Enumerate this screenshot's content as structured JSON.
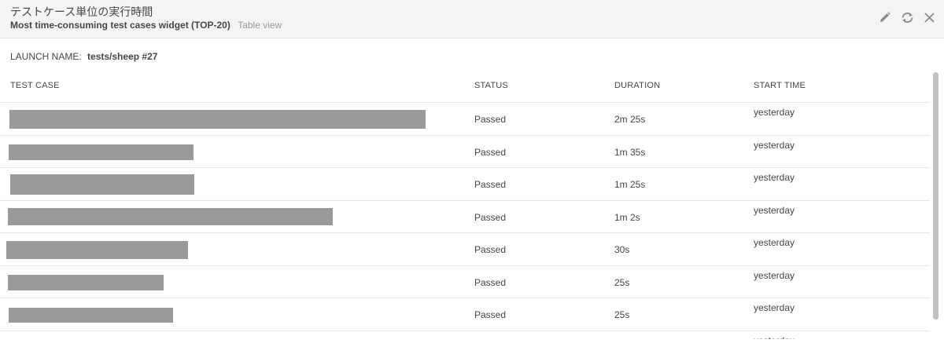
{
  "header": {
    "title": "テストケース単位の実行時間",
    "subtitle": "Most time-consuming test cases widget (TOP-20)",
    "view_mode": "Table view",
    "controls": [
      {
        "icon": "pencil-icon",
        "name": "edit-button"
      },
      {
        "icon": "refresh-icon",
        "name": "refresh-button"
      },
      {
        "icon": "close-icon",
        "name": "close-button"
      }
    ]
  },
  "launch": {
    "label": "LAUNCH NAME:",
    "value": "tests/sheep #27"
  },
  "table": {
    "columns": {
      "test_case": "TEST CASE",
      "status": "STATUS",
      "duration": "DURATION",
      "start_time": "START TIME"
    },
    "rows": [
      {
        "test_case_redacted": true,
        "status": "Passed",
        "duration": "2m 25s",
        "start_time": "yesterday"
      },
      {
        "test_case_redacted": true,
        "status": "Passed",
        "duration": "1m 35s",
        "start_time": "yesterday"
      },
      {
        "test_case_redacted": true,
        "status": "Passed",
        "duration": "1m 25s",
        "start_time": "yesterday"
      },
      {
        "test_case_redacted": true,
        "status": "Passed",
        "duration": "1m 2s",
        "start_time": "yesterday"
      },
      {
        "test_case_redacted": true,
        "status": "Passed",
        "duration": "30s",
        "start_time": "yesterday"
      },
      {
        "test_case_redacted": true,
        "status": "Passed",
        "duration": "25s",
        "start_time": "yesterday"
      },
      {
        "test_case_redacted": true,
        "status": "Passed",
        "duration": "25s",
        "start_time": "yesterday"
      },
      {
        "test_case_redacted": true,
        "status": "",
        "duration": "",
        "start_time": "yesterday"
      }
    ]
  },
  "colors": {
    "header_bg": "#f4f4f4",
    "redaction": "#9a9a9a",
    "text": "#464547",
    "muted": "#999999",
    "divider": "#e6e6e6"
  }
}
